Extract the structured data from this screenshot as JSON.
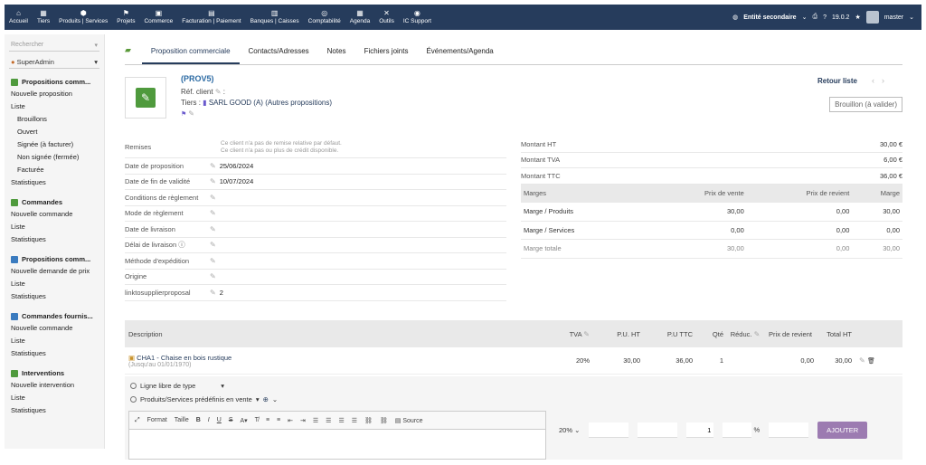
{
  "topbar": {
    "menu": [
      {
        "icon": "home-icon",
        "glyph": "⌂",
        "label": "Accueil"
      },
      {
        "icon": "building-icon",
        "glyph": "▦",
        "label": "Tiers"
      },
      {
        "icon": "cube-icon",
        "glyph": "⬢",
        "label": "Produits | Services"
      },
      {
        "icon": "sitemap-icon",
        "glyph": "⚑",
        "label": "Projets"
      },
      {
        "icon": "suitcase-icon",
        "glyph": "▣",
        "label": "Commerce"
      },
      {
        "icon": "file-invoice-icon",
        "glyph": "▤",
        "label": "Facturation | Paiement"
      },
      {
        "icon": "bank-icon",
        "glyph": "▥",
        "label": "Banques | Caisses"
      },
      {
        "icon": "search-dollar-icon",
        "glyph": "◎",
        "label": "Comptabilité"
      },
      {
        "icon": "calendar-icon",
        "glyph": "▦",
        "label": "Agenda"
      },
      {
        "icon": "tools-icon",
        "glyph": "✕",
        "label": "Outils"
      },
      {
        "icon": "support-icon",
        "glyph": "◉",
        "label": "IC Support"
      }
    ],
    "entity": "Entité secondaire",
    "version": "19.0.2",
    "user": "master"
  },
  "sidebar": {
    "search_placeholder": "Rechercher",
    "user_select": "SuperAdmin",
    "sections": [
      {
        "title": "Propositions comm...",
        "color": "#4f9a3d",
        "links": [
          {
            "label": "Nouvelle proposition",
            "sub": false
          },
          {
            "label": "Liste",
            "sub": false
          },
          {
            "label": "Brouillons",
            "sub": true
          },
          {
            "label": "Ouvert",
            "sub": true
          },
          {
            "label": "Signée (à facturer)",
            "sub": true
          },
          {
            "label": "Non signée (fermée)",
            "sub": true
          },
          {
            "label": "Facturée",
            "sub": true
          },
          {
            "label": "Statistiques",
            "sub": false
          }
        ]
      },
      {
        "title": "Commandes",
        "color": "#4f9a3d",
        "links": [
          {
            "label": "Nouvelle commande",
            "sub": false
          },
          {
            "label": "Liste",
            "sub": false
          },
          {
            "label": "Statistiques",
            "sub": false
          }
        ]
      },
      {
        "title": "Propositions comm...",
        "color": "#3a7bbf",
        "links": [
          {
            "label": "Nouvelle demande de prix",
            "sub": false
          },
          {
            "label": "Liste",
            "sub": false
          },
          {
            "label": "Statistiques",
            "sub": false
          }
        ]
      },
      {
        "title": "Commandes fournis...",
        "color": "#3a7bbf",
        "links": [
          {
            "label": "Nouvelle commande",
            "sub": false
          },
          {
            "label": "Liste",
            "sub": false
          },
          {
            "label": "Statistiques",
            "sub": false
          }
        ]
      },
      {
        "title": "Interventions",
        "color": "#4f9a3d",
        "links": [
          {
            "label": "Nouvelle intervention",
            "sub": false
          },
          {
            "label": "Liste",
            "sub": false
          },
          {
            "label": "Statistiques",
            "sub": false
          }
        ]
      }
    ]
  },
  "tabs": [
    "Proposition commerciale",
    "Contacts/Adresses",
    "Notes",
    "Fichiers joints",
    "Événements/Agenda"
  ],
  "header": {
    "ref": "(PROV5)",
    "ref_client_label": "Réf. client",
    "tiers_label": "Tiers :",
    "tiers_value": "SARL GOOD (A) (Autres propositions)",
    "retour": "Retour liste",
    "status": "Brouillon (à valider)"
  },
  "fields": {
    "remise_label": "Remises",
    "remise_line1": "Ce client n'a pas de remise relative par défaut.",
    "remise_line2": "Ce client n'a pas ou plus de crédit disponible.",
    "rows": [
      {
        "label": "Date de proposition",
        "value": "25/06/2024"
      },
      {
        "label": "Date de fin de validité",
        "value": "10/07/2024"
      },
      {
        "label": "Conditions de règlement",
        "value": ""
      },
      {
        "label": "Mode de règlement",
        "value": ""
      },
      {
        "label": "Date de livraison",
        "value": ""
      },
      {
        "label": "Délai de livraison ⓘ",
        "value": ""
      },
      {
        "label": "Méthode d'expédition",
        "value": ""
      },
      {
        "label": "Origine",
        "value": ""
      },
      {
        "label": "linktosupplierproposal",
        "value": "2"
      }
    ]
  },
  "amounts": {
    "rows": [
      {
        "label": "Montant HT",
        "value": "30,00 €"
      },
      {
        "label": "Montant TVA",
        "value": "6,00 €"
      },
      {
        "label": "Montant TTC",
        "value": "36,00 €"
      }
    ],
    "marges_head": [
      "Marges",
      "Prix de vente",
      "Prix de revient",
      "Marge"
    ],
    "marges_rows": [
      [
        "Marge / Produits",
        "30,00",
        "0,00",
        "30,00"
      ],
      [
        "Marge / Services",
        "0,00",
        "0,00",
        "0,00"
      ],
      [
        "Marge totale",
        "30,00",
        "0,00",
        "30,00"
      ]
    ]
  },
  "lines": {
    "head": {
      "desc": "Description",
      "tva": "TVA",
      "puht": "P.U. HT",
      "puttc": "P.U TTC",
      "qty": "Qté",
      "red": "Réduc.",
      "pr": "Prix de revient",
      "tht": "Total HT"
    },
    "rows": [
      {
        "product": "CHA1 - Chaise en bois rustique",
        "sub": "(Jusqu'au 01/01/1970)",
        "tva": "20%",
        "puht": "30,00",
        "puttc": "36,00",
        "qty": "1",
        "red": "",
        "pr": "0,00",
        "tht": "30,00"
      }
    ]
  },
  "addline": {
    "free_label": "Ligne libre de type",
    "predef_label": "Produits/Services prédéfinis en vente",
    "editor_format": "Format",
    "editor_size": "Taille",
    "editor_source": "Source",
    "tva": "20%",
    "qty": "1",
    "pct": "%",
    "add_button": "AJOUTER"
  }
}
